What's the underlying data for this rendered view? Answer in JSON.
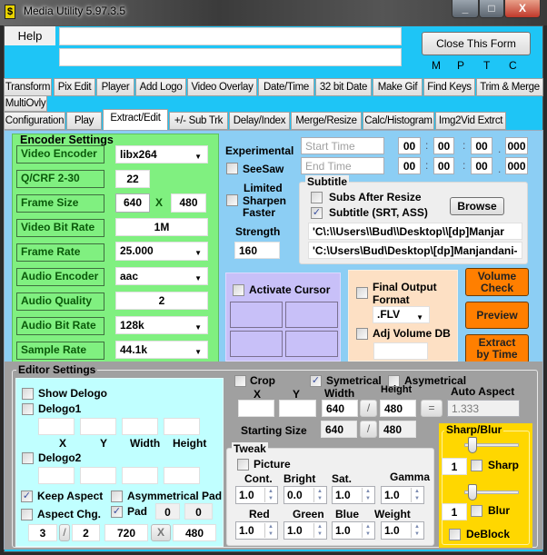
{
  "window": {
    "title": "Media Utility 5.97.3.5",
    "minimize": "_",
    "maximize": "□",
    "close": "X"
  },
  "header": {
    "help_label": "Help",
    "input1_value": "",
    "input2_value": "",
    "close_form_label": "Close This Form",
    "indicators": [
      "M",
      "P",
      "T",
      "C"
    ]
  },
  "tabs_row1": [
    "Transform",
    "Pix Edit",
    "Player",
    "Add Logo",
    "Video Overlay",
    "Date/Time",
    "32 bit Date",
    "Make Gif",
    "Find Keys",
    "Trim & Merge",
    "MultiOvly"
  ],
  "tabs_row2": [
    "Configuration",
    "Play",
    "Extract/Edit",
    "+/- Sub Trk",
    "Delay/Index",
    "Merge/Resize",
    "Calc/Histogram",
    "Img2Vid Extrct"
  ],
  "active_tab": "Extract/Edit",
  "encoder": {
    "legend": "Encoder Settings",
    "video_encoder_label": "Video Encoder",
    "video_encoder": "libx264",
    "qcrf_label": "Q/CRF  2-30",
    "qcrf": "22",
    "frame_size_label": "Frame Size",
    "frame_w": "640",
    "frame_x": "X",
    "frame_h": "480",
    "video_bitrate_label": "Video Bit Rate",
    "video_bitrate": "1M",
    "frame_rate_label": "Frame Rate",
    "frame_rate": "25.000",
    "audio_encoder_label": "Audio Encoder",
    "audio_encoder": "aac",
    "audio_quality_label": "Audio Quality",
    "audio_quality": "2",
    "audio_bitrate_label": "Audio Bit Rate",
    "audio_bitrate": "128k",
    "sample_rate_label": "Sample Rate",
    "sample_rate": "44.1k"
  },
  "experimental": {
    "label": "Experimental",
    "seesaw_label": "SeeSaw",
    "seesaw_checked": false,
    "limited_line1": "Limited",
    "limited_line2": "Sharpen",
    "limited_line3": "Faster",
    "limited_checked": false,
    "strength_label": "Strength",
    "strength": "160"
  },
  "time": {
    "start_placeholder": "Start Time",
    "end_placeholder": "End Time",
    "start": [
      "00",
      "00",
      "00",
      "000"
    ],
    "end": [
      "00",
      "00",
      "00",
      "000"
    ],
    "sep_colon": ":",
    "sep_dot": "."
  },
  "subtitle": {
    "legend": "Subtitle",
    "subs_after_resize_label": "Subs After Resize",
    "subs_after_resize_checked": false,
    "subtitle_label": "Subtitle (SRT, ASS)",
    "subtitle_checked": true,
    "browse_label": "Browse",
    "path_escaped": "'C\\:\\\\Users\\\\Bud\\\\Desktop\\\\[dp]Manjar",
    "path": "'C:\\Users\\Bud\\Desktop\\[dp]Manjandani-"
  },
  "cursor": {
    "activate_label": "Activate Cursor",
    "checked": false
  },
  "output": {
    "final_line1": "Final Output",
    "final_line2": "Format",
    "final_checked": false,
    "format": ".FLV",
    "adj_volume_label": "Adj Volume DB",
    "adj_volume_checked": false,
    "adj_volume_value": ""
  },
  "actions": {
    "volume_check_1": "Volume",
    "volume_check_2": "Check",
    "preview": "Preview",
    "extract_1": "Extract",
    "extract_2": "by Time"
  },
  "editor": {
    "legend": "Editor Settings",
    "show_delogo_label": "Show Delogo",
    "delogo1_label": "Delogo1",
    "delogo2_label": "Delogo2",
    "delogo_cols": [
      "X",
      "Y",
      "Width",
      "Height"
    ],
    "keep_aspect_label": "Keep Aspect",
    "keep_aspect_checked": true,
    "asym_pad_label": "Asymmetrical Pad",
    "aspect_chg_label": "Aspect Chg.",
    "pad_label": "Pad",
    "pad_checked": true,
    "pad_a": "0",
    "pad_b": "0",
    "aspect_num": "3",
    "aspect_slash": "/",
    "aspect_den": "2",
    "out_w": "720",
    "out_x": "X",
    "out_h": "480"
  },
  "crop": {
    "crop_label": "Crop",
    "symetrical_label": "Symetrical",
    "symetrical_checked": true,
    "asymetrical_label": "Asymetrical",
    "x_label": "X",
    "y_label": "Y",
    "width_label": "Width",
    "height_label": "Height",
    "auto_aspect_label": "Auto Aspect",
    "width": "640",
    "slash": "/",
    "height": "480",
    "equals": "=",
    "auto_aspect": "1.333",
    "starting_size_label": "Starting Size",
    "start_w": "640",
    "start_h": "480"
  },
  "tweak": {
    "legend": "Tweak",
    "picture_label": "Picture",
    "row1_labels": [
      "Cont.",
      "Bright",
      "Sat.",
      "Gamma"
    ],
    "row1_values": [
      "1.0",
      "0.0",
      "1.0",
      "1.0"
    ],
    "row2_labels": [
      "Red",
      "Green",
      "Blue",
      "Weight"
    ],
    "row2_values": [
      "1.0",
      "1.0",
      "1.0",
      "1.0"
    ]
  },
  "sharpblur": {
    "legend": "Sharp/Blur",
    "sharp_value": "1",
    "sharp_label": "Sharp",
    "blur_value": "1",
    "blur_label": "Blur",
    "deblock_label": "DeBlock",
    "sharp_slider": 1,
    "blur_slider": 1
  },
  "colors": {
    "body": "#1ec5f6",
    "panel": "#8ccef4",
    "encoder": "#80f080",
    "cursor": "#c8c0f8",
    "output": "#fde0c4",
    "action": "#ff7f00",
    "delogo": "#c0ffff",
    "sharpblur": "#ffd700",
    "editor": "#a0a0a0"
  }
}
